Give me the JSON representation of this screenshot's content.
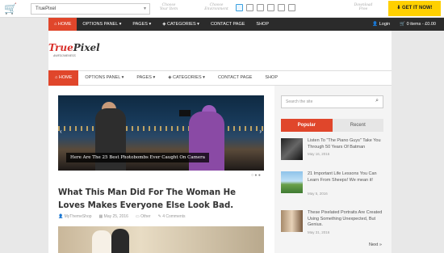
{
  "toolbar": {
    "theme_select": "TruePixel",
    "hint_choose_theme": "Choose\nYour Item",
    "hint_choose_device": "Choose\nEnvironment",
    "hint_download": "Download\nFree",
    "get_it_label": "GET IT NOW!"
  },
  "top_nav": {
    "items": [
      "HOME",
      "OPTIONS PANEL",
      "PAGES",
      "CATEGORIES",
      "CONTACT PAGE",
      "SHOP"
    ],
    "login": "Login",
    "cart": "0 items - £0.00"
  },
  "logo": {
    "part1": "True",
    "part2": "Pixel",
    "tagline": "AWESOMENESS"
  },
  "main_nav": {
    "items": [
      "HOME",
      "OPTIONS PANEL",
      "PAGES",
      "CATEGORIES",
      "CONTACT PAGE",
      "SHOP"
    ]
  },
  "slider": {
    "caption": "Here Are The 25 Best Photobombs Ever Caught On Camera"
  },
  "post": {
    "title": "What This Man Did For The Woman He Loves Makes Everyone Else Look Bad.",
    "author": "MyThemeShop",
    "date": "May 25, 2016",
    "category": "Other",
    "comments": "4 Comments"
  },
  "sidebar": {
    "search_placeholder": "Search the site",
    "tab_popular": "Popular",
    "tab_recent": "Recent",
    "items": [
      {
        "title": "Listen To \"The Piano Guys\" Take You Through 50 Years Of Batman",
        "date": "May 16, 2016"
      },
      {
        "title": "21 Important Life Lessons You Can Learn From Sheeps! We mean it!",
        "date": "May 5, 2016"
      },
      {
        "title": "These Pixelated Portraits Are Created Using Something Unexpected, But Genius.",
        "date": "May 31, 2016"
      }
    ],
    "next": "Next »"
  },
  "colors": {
    "accent": "#e0462b",
    "dark_nav": "#2b2b2b",
    "cta": "#ffd000"
  }
}
